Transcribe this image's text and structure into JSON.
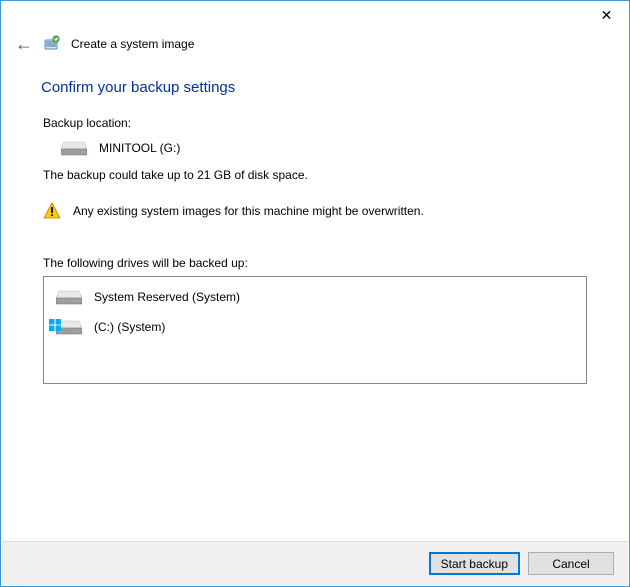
{
  "titlebar": {
    "close_glyph": "✕"
  },
  "header": {
    "back_glyph": "←",
    "wizard_title": "Create a system image"
  },
  "main": {
    "heading": "Confirm your backup settings",
    "backup_location_label": "Backup location:",
    "backup_location_value": "MINITOOL (G:)",
    "size_estimate": "The backup could take up to 21 GB of disk space.",
    "warning_text": "Any existing system images for this machine might be overwritten.",
    "drives_label": "The following drives will be backed up:",
    "drives": [
      {
        "label": "System Reserved (System)",
        "is_os": false
      },
      {
        "label": "(C:) (System)",
        "is_os": true
      }
    ]
  },
  "footer": {
    "start_label": "Start backup",
    "cancel_label": "Cancel"
  }
}
